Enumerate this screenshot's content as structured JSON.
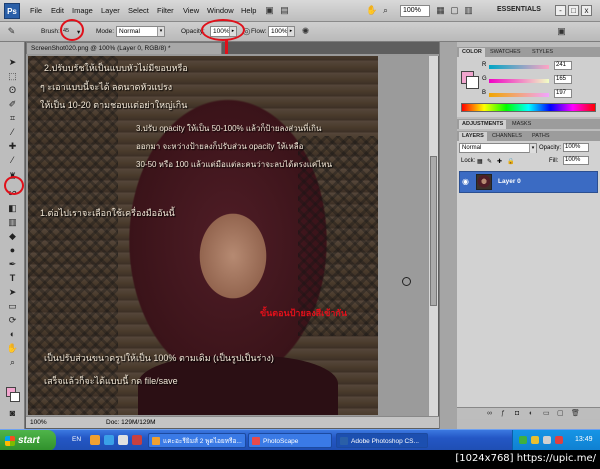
{
  "menu": {
    "app_logo": "Ps",
    "items": [
      "File",
      "Edit",
      "Image",
      "Layer",
      "Select",
      "Filter",
      "View",
      "Window",
      "Help"
    ],
    "zoom": "100%",
    "workspace": "ESSENTIALS",
    "win_controls": [
      "-",
      "□",
      "x"
    ]
  },
  "options": {
    "brush_label": "Brush:",
    "brush_size": "45",
    "mode_label": "Mode:",
    "mode_value": "Normal",
    "opacity_label": "Opacity:",
    "opacity_value": "100%",
    "flow_label": "Flow:",
    "flow_value": "100%"
  },
  "document": {
    "tab_title": "ScreenShot020.png @ 100% (Layer 0, RGB/8) *",
    "status_zoom": "100%",
    "status_doc": "Doc: 129M/129M"
  },
  "overlay": {
    "line1": "2.ปรับบรัชให้เป็นแบบหัวไม่มีขอบหรือ",
    "line2": "ๆ ะเอาแบบนี้จะได้ ลดนาดหัวแปรง",
    "line3": "ให้เป็น 10-20 ตามชอบแต่อย่าใหญ่เกิน",
    "line4": "3.ปรับ opacity ให้เป็น 50-100% แล้วก็ป้ายลงส่วนที่เกิน",
    "line5": "ออกมา จะหว่างป้ายลงก็ปรับส่วน opacity ให้เหลือ",
    "line6": "30-50 หรือ 100 แล้วแต่มือแต่ละคนว่าจะลบได้ตรงแค่ไหน",
    "line7": "1.ต่อไปเราจะเลือกใช้เครื่องมืออันนี้",
    "line8": "เป็นปรับส่วนขนาดรูปให้เป็น 100% ตามเดิม (เป็นรูปเป็นร่าง)",
    "line9": "เสร็จแล้วก็จะได้แบบนี้  กด file/save",
    "note_red": "ขั้นตอนป้ายลงสีเข้ากัน"
  },
  "color_panel": {
    "tabs": [
      "COLOR",
      "SWATCHES",
      "STYLES"
    ],
    "r_label": "R",
    "r_value": "241",
    "g_label": "G",
    "g_value": "165",
    "b_label": "B",
    "b_value": "197",
    "fg_color": "#f1a5ce"
  },
  "adjust_panel": {
    "tabs": [
      "ADJUSTMENTS",
      "MASKS"
    ]
  },
  "layers_panel": {
    "tabs": [
      "LAYERS",
      "CHANNELS",
      "PATHS"
    ],
    "blend_mode": "Normal",
    "opacity_label": "Opacity:",
    "opacity_value": "100%",
    "lock_label": "Lock:",
    "fill_label": "Fill:",
    "fill_value": "100%",
    "layers": [
      {
        "name": "Layer 0"
      }
    ]
  },
  "taskbar": {
    "start": "start",
    "lang": "EN",
    "tasks": [
      {
        "label": "แคะอะรียิมส์ 2 พูดไอยหรือ...",
        "active": false
      },
      {
        "label": "PhotoScape",
        "active": false
      },
      {
        "label": "Adobe Photoshop CS...",
        "active": true
      }
    ],
    "clock": "13:49"
  },
  "watermark": "[1024x768] https://upic.me/",
  "colors": {
    "annotation_red": "#e0101a",
    "layer_selected": "#3b6bc3",
    "taskbar_blue": "#2457c5"
  }
}
